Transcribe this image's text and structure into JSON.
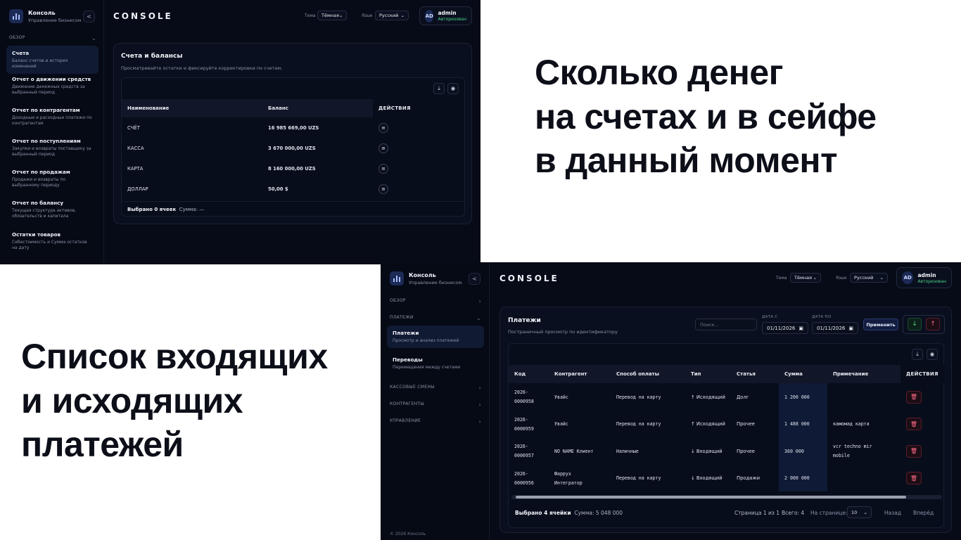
{
  "captions": {
    "top": [
      "Сколько денег",
      "на счетах и в сейфе",
      "в данный момент"
    ],
    "bottom": [
      "Список входящих",
      "и исходящих",
      "платежей"
    ]
  },
  "screen1": {
    "brand": {
      "name": "Консоль",
      "sub": "Управление бизнесом",
      "collapse": "<"
    },
    "section": {
      "label": "ОБЗОР",
      "chevron": "⌄"
    },
    "nav": [
      {
        "title": "Счета",
        "desc": "Баланс счетов и история изменений",
        "active": true
      },
      {
        "title": "Отчет о движении средств",
        "desc": "Движение денежных средств за выбранный период"
      },
      {
        "title": "Отчет по контрагентам",
        "desc": "Доходные и расходные платежи по контрагентам"
      },
      {
        "title": "Отчет по поступлениям",
        "desc": "Закупки и возвраты поставщику за выбранный период"
      },
      {
        "title": "Отчет по продажам",
        "desc": "Продажи и возвраты по выбранному периоду"
      },
      {
        "title": "Отчет по балансу",
        "desc": "Текущая структура активов, обязательств и капитала"
      },
      {
        "title": "Остатки товаров",
        "desc": "Себестоимость и Сумма остатков на дату"
      }
    ],
    "header": {
      "title": "CONSOLE",
      "theme_label": "Тема",
      "theme_value": "Тёмная",
      "lang_label": "Язык",
      "lang_value": "Русский"
    },
    "user": {
      "initials": "AD",
      "name": "admin",
      "status": "Авторизован"
    },
    "card": {
      "title": "Счета и балансы",
      "subtitle": "Просматривайте остатки и фиксируйте корректировки по счетам."
    },
    "table": {
      "headers": [
        "Наименование",
        "Баланс",
        "ДЕЙСТВИЯ"
      ],
      "rows": [
        {
          "name": "СЧЁТ",
          "balance": "16 985 669,00 UZS"
        },
        {
          "name": "КАССА",
          "balance": "3 670 000,00 UZS"
        },
        {
          "name": "КАРТА",
          "balance": "8 160 000,00 UZS"
        },
        {
          "name": "ДОЛЛАР",
          "balance": "50,00 $"
        }
      ]
    },
    "footer": {
      "selected": "Выбрано 0 ячеек",
      "sum": "Сумма: —"
    }
  },
  "screen2": {
    "brand": {
      "name": "Консоль",
      "sub": "Управление бизнесом",
      "collapse": "<"
    },
    "sections": [
      {
        "label": "ОБЗОР",
        "chevron": "›"
      },
      {
        "label": "ПЛАТЕЖИ",
        "chevron": "⌄"
      },
      {
        "label": "КАССОВЫЕ СМЕНЫ",
        "chevron": "›"
      },
      {
        "label": "КОНТРАГЕНТЫ",
        "chevron": "›"
      },
      {
        "label": "УПРАВЛЕНИЕ",
        "chevron": "›"
      }
    ],
    "nav": [
      {
        "title": "Платежи",
        "desc": "Просмотр и анализ платежей",
        "active": true
      },
      {
        "title": "Переводы",
        "desc": "Перемещения между счетами"
      }
    ],
    "copyright": "© 2026 Консоль",
    "header": {
      "title": "CONSOLE",
      "theme_label": "Тема",
      "theme_value": "Тёмная",
      "lang_label": "Язык",
      "lang_value": "Русский"
    },
    "user": {
      "initials": "AD",
      "name": "admin",
      "status": "Авторизован"
    },
    "card": {
      "title": "Платежи",
      "subtitle": "Постраничный просмотр по идентификатору"
    },
    "filters": {
      "search_placeholder": "Поиск...",
      "date_from_label": "ДАТА С",
      "date_from": "01/11/2026",
      "date_to_label": "ДАТА ПО",
      "date_to": "01/11/2026",
      "apply": "Применить"
    },
    "table": {
      "headers": [
        "Код",
        "Контрагент",
        "Способ оплаты",
        "Тип",
        "Статья",
        "Сумма",
        "Примечание",
        "ДЕЙСТВИЯ"
      ],
      "rows": [
        {
          "code1": "2026-",
          "code2": "0000958",
          "party1": "Увайс",
          "party2": "",
          "method": "Перевод на карту",
          "type": "↑ Исходящий",
          "article": "Долг",
          "sum": "1 200 000",
          "note1": "",
          "note2": ""
        },
        {
          "code1": "2026-",
          "code2": "0000959",
          "party1": "Увайс",
          "party2": "",
          "method": "Перевод на карту",
          "type": "↑ Исходящий",
          "article": "Прочее",
          "sum": "1 488 000",
          "note1": "камомад карта",
          "note2": ""
        },
        {
          "code1": "2026-",
          "code2": "0000957",
          "party1": "NO NAME Клиент",
          "party2": "",
          "method": "Наличные",
          "type": "↓ Входящий",
          "article": "Прочее",
          "sum": "360 000",
          "note1": "vcr techno mir",
          "note2": "mobile"
        },
        {
          "code1": "2026-",
          "code2": "0000956",
          "party1": "Фаррух",
          "party2": "Интегратор",
          "method": "Перевод на карту",
          "type": "↓ Входящий",
          "article": "Продажи",
          "sum": "2 000 000",
          "note1": "",
          "note2": ""
        }
      ]
    },
    "footer": {
      "selected": "Выбрано 4 ячейки",
      "sum": "Сумма: 5 048 000",
      "page": "Страница 1 из 1",
      "total": "Всего: 4",
      "per_page_label": "На странице:",
      "per_page": "10",
      "prev": "Назад",
      "next": "Вперёд"
    }
  }
}
